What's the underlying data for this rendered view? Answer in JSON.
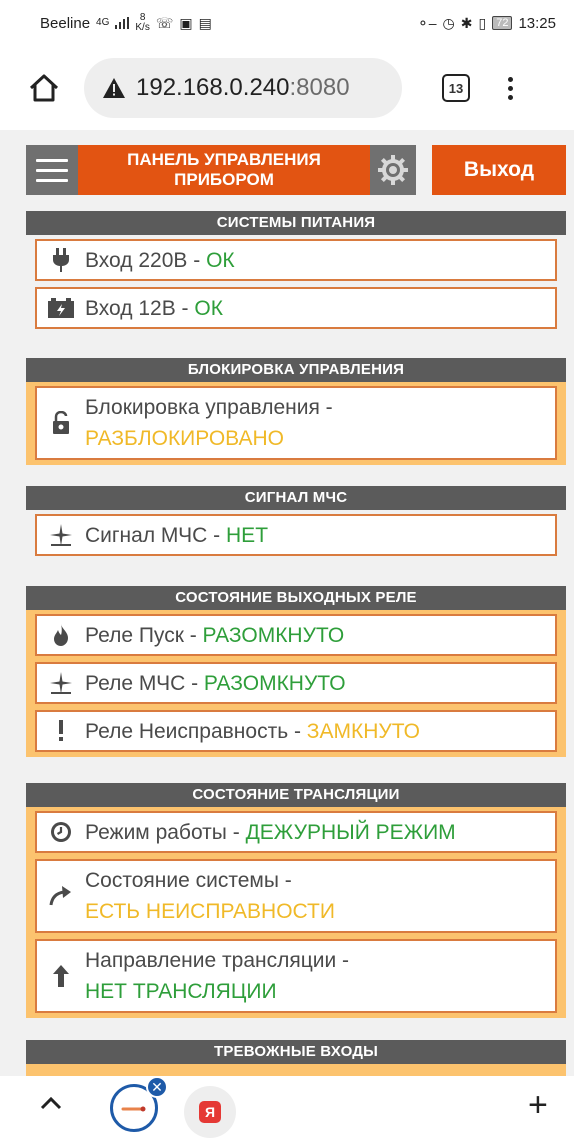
{
  "status_bar": {
    "carrier": "Beeline",
    "network": "4G",
    "speed_value": "8",
    "speed_unit": "K/s",
    "battery": "72",
    "time": "13:25"
  },
  "browser": {
    "url_host": "192.168.0.240",
    "url_port": ":8080",
    "tab_count": "13"
  },
  "header": {
    "title": "ПАНЕЛЬ УПРАВЛЕНИЯ ПРИБОРОМ",
    "logout_label": "Выход"
  },
  "sections": [
    {
      "title": "СИСТЕМЫ ПИТАНИЯ",
      "rows": [
        {
          "icon": "plug-icon",
          "label": "Вход 220В - ",
          "value": "ОК"
        },
        {
          "icon": "battery-icon",
          "label": "Вход 12В - ",
          "value": "ОК"
        }
      ]
    },
    {
      "title": "БЛОКИРОВКА УПРАВЛЕНИЯ",
      "rows": [
        {
          "icon": "unlock-icon",
          "label": "Блокировка управления -",
          "value": "РАЗБЛОКИРОВАНО"
        }
      ]
    },
    {
      "title": "СИГНАЛ МЧС",
      "rows": [
        {
          "icon": "signal-star-icon",
          "label": "Сигнал МЧС - ",
          "value": "НЕТ"
        }
      ]
    },
    {
      "title": "СОСТОЯНИЕ ВЫХОДНЫХ РЕЛЕ",
      "rows": [
        {
          "icon": "fire-icon",
          "label": "Реле Пуск - ",
          "value": "РАЗОМКНУТО"
        },
        {
          "icon": "signal-star-icon",
          "label": "Реле МЧС - ",
          "value": "РАЗОМКНУТО"
        },
        {
          "icon": "exclamation-icon",
          "label": "Реле Неисправность - ",
          "value": "ЗАМКНУТО"
        }
      ]
    },
    {
      "title": "СОСТОЯНИЕ ТРАНСЛЯЦИИ",
      "rows": [
        {
          "icon": "clock-icon",
          "label": "Режим работы - ",
          "value": "ДЕЖУРНЫЙ РЕЖИМ"
        },
        {
          "icon": "curved-arrow-icon",
          "label": "Состояние системы -",
          "value": "ЕСТЬ НЕИСПРАВНОСТИ"
        },
        {
          "icon": "arrow-up-icon",
          "label": "Направление трансляции -",
          "value": "НЕТ ТРАНСЛЯЦИИ"
        }
      ]
    },
    {
      "title": "ТРЕВОЖНЫЕ ВХОДЫ"
    }
  ],
  "colors": {
    "accent_orange": "#e25412",
    "header_gray": "#5b5b5b",
    "highlight_yellow": "#fcc36e",
    "status_ok": "#2e9e3a",
    "status_warn": "#f0b928"
  },
  "bottom_bar": {
    "ya_label": "Я"
  }
}
